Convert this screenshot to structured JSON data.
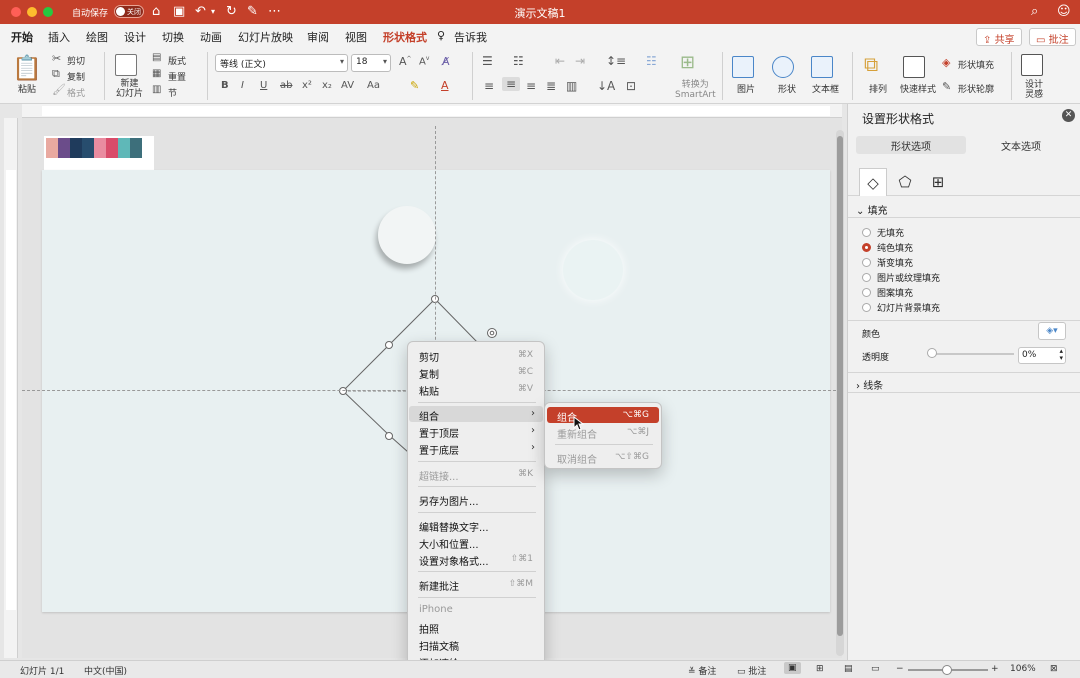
{
  "titlebar": {
    "autosave_label": "自动保存",
    "autosave_state": "关闭",
    "doc_title": "演示文稿1",
    "colors": {
      "bar": "#c4402a",
      "close": "#ff5f57",
      "minimize": "#febc2e",
      "zoom": "#28c840"
    }
  },
  "tabs": [
    "开始",
    "插入",
    "绘图",
    "设计",
    "切换",
    "动画",
    "幻灯片放映",
    "审阅",
    "视图",
    "形状格式",
    "告诉我"
  ],
  "share_label": "共享",
  "comment_label": "批注",
  "ribbon": {
    "paste": "粘贴",
    "cut": "剪切",
    "copy": "复制",
    "format": "格式",
    "new_slide": "新建\n幻灯片",
    "layout": "版式",
    "reset": "重置",
    "section": "节",
    "font_name": "等线 (正文)",
    "font_size": "18",
    "convert_smartart": "转换为\nSmartArt",
    "picture": "图片",
    "shape": "形状",
    "textbox": "文本框",
    "arrange": "排列",
    "quick_styles": "快速样式",
    "shape_fill": "形状填充",
    "shape_outline": "形状轮廓",
    "designer": "设计\n灵感"
  },
  "swatches": [
    "#e9a9a0",
    "#6b4c8a",
    "#1f3b5c",
    "#274d6e",
    "#e98ca0",
    "#d94c6a",
    "#5fb8b8",
    "#3d6f7b"
  ],
  "context_menu": {
    "items": [
      {
        "label": "剪切",
        "shortcut": "⌘X"
      },
      {
        "label": "复制",
        "shortcut": "⌘C"
      },
      {
        "label": "粘贴",
        "shortcut": "⌘V"
      },
      {
        "label": "组合",
        "shortcut": ""
      },
      {
        "label": "置于顶层",
        "shortcut": ""
      },
      {
        "label": "置于底层",
        "shortcut": ""
      },
      {
        "label": "超链接...",
        "shortcut": "⌘K"
      },
      {
        "label": "另存为图片...",
        "shortcut": ""
      },
      {
        "label": "编辑替换文字...",
        "shortcut": ""
      },
      {
        "label": "大小和位置...",
        "shortcut": ""
      },
      {
        "label": "设置对象格式...",
        "shortcut": "⇧⌘1"
      },
      {
        "label": "新建批注",
        "shortcut": "⇧⌘M"
      },
      {
        "label": "iPhone",
        "shortcut": ""
      },
      {
        "label": "拍照",
        "shortcut": ""
      },
      {
        "label": "扫描文稿",
        "shortcut": ""
      },
      {
        "label": "添加速绘",
        "shortcut": ""
      }
    ]
  },
  "submenu": {
    "items": [
      {
        "label": "组合",
        "shortcut": "⌥⌘G"
      },
      {
        "label": "重新组合",
        "shortcut": "⌥⌘J"
      },
      {
        "label": "取消组合",
        "shortcut": "⌥⇧⌘G"
      }
    ]
  },
  "pane": {
    "title": "设置形状格式",
    "tab_shape": "形状选项",
    "tab_text": "文本选项",
    "fill_section": "填充",
    "fill_options": [
      "无填充",
      "纯色填充",
      "渐变填充",
      "图片或纹理填充",
      "图案填充",
      "幻灯片背景填充"
    ],
    "color_label": "颜色",
    "transparency_label": "透明度",
    "transparency_value": "0%",
    "line_section": "线条"
  },
  "status": {
    "slide": "幻灯片 1/1",
    "language": "中文(中国)",
    "notes": "备注",
    "comments": "批注",
    "zoom": "106%"
  }
}
